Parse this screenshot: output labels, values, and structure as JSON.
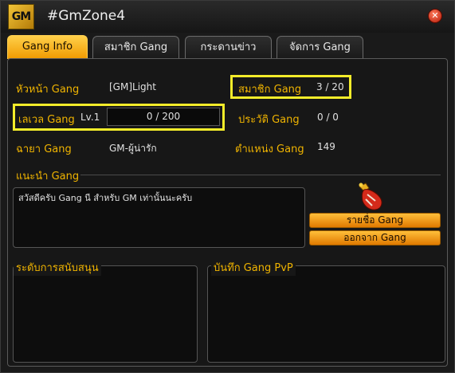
{
  "window": {
    "title": "#GmZone4",
    "logo_text": "GM",
    "close_glyph": "✕"
  },
  "tabs": [
    {
      "label": "Gang Info",
      "active": true
    },
    {
      "label": "สมาชิก Gang",
      "active": false
    },
    {
      "label": "กระดานข่าว",
      "active": false
    },
    {
      "label": "จัดการ Gang",
      "active": false
    }
  ],
  "info": {
    "leader_label": "หัวหน้า Gang",
    "leader_value": "[GM]Light",
    "members_label": "สมาชิก Gang",
    "members_value": "3 / 20",
    "level_label": "เลเวล Gang",
    "level_badge": "Lv.1",
    "level_exp": "0 / 200",
    "history_label": "ประวัติ Gang",
    "history_value": "0 / 0",
    "alias_label": "ฉายา Gang",
    "alias_value": "GM-ผู้น่ารัก",
    "rank_label": "ตำแหน่ง Gang",
    "rank_value": "149"
  },
  "intro": {
    "label": "แนะนำ Gang",
    "text": "สวัสดีครับ Gang นี สำหรับ GM เท่านั้นนะครับ"
  },
  "buttons": {
    "list_label": "รายชื่อ Gang",
    "leave_label": "ออกจาก Gang"
  },
  "sections": {
    "support_label": "ระดับการสนับสนุน",
    "pvp_label": "บันทึก Gang PvP"
  },
  "colors": {
    "accent": "#f0b400",
    "highlight": "#f4ec2a",
    "tab_active": "#ffb21e"
  },
  "icons": {
    "glove": "boxing-glove-icon"
  }
}
